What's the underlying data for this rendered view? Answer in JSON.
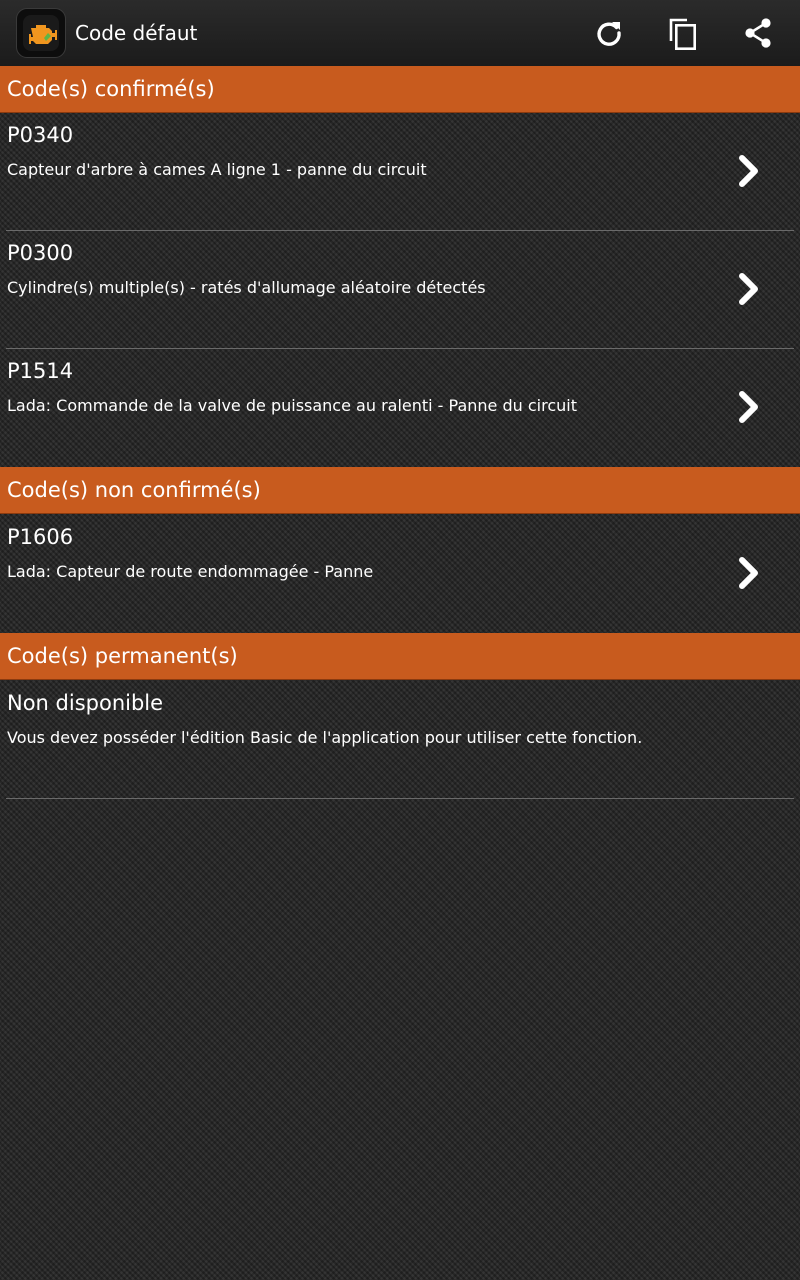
{
  "app": {
    "title": "Code défaut",
    "icon": "check-engine-icon"
  },
  "toolbar": {
    "refresh_icon": "refresh-icon",
    "copy_icon": "copy-icon",
    "share_icon": "share-icon"
  },
  "colors": {
    "section_header": "#c85b1e",
    "engine_icon": "#f0961f"
  },
  "sections": [
    {
      "title": "Code(s) confirmé(s)",
      "items": [
        {
          "code": "P0340",
          "description": "Capteur d'arbre à cames A ligne 1 - panne du circuit"
        },
        {
          "code": "P0300",
          "description": "Cylindre(s) multiple(s) - ratés d'allumage aléatoire détectés"
        },
        {
          "code": "P1514",
          "description": "Lada: Commande de la valve de puissance au ralenti - Panne du circuit"
        }
      ]
    },
    {
      "title": "Code(s) non confirmé(s)",
      "items": [
        {
          "code": "P1606",
          "description": "Lada: Capteur de route endommagée - Panne"
        }
      ]
    },
    {
      "title": "Code(s) permanent(s)",
      "items": [
        {
          "code": "Non disponible",
          "description": "Vous devez posséder l'édition Basic de l'application pour utiliser cette fonction."
        }
      ]
    }
  ]
}
